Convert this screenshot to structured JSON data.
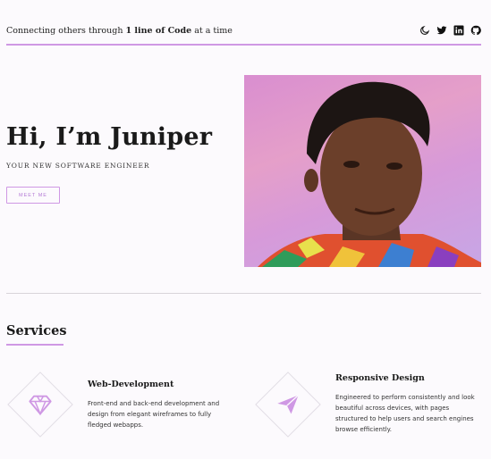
{
  "header": {
    "tagline_prefix": "Connecting others through ",
    "tagline_bold": "1 line of Code",
    "tagline_suffix": " at a time",
    "social_icons": [
      "moon-icon",
      "twitter-icon",
      "linkedin-icon",
      "github-icon"
    ]
  },
  "hero": {
    "title": "Hi, I’m Juniper",
    "subtitle": "YOUR NEW SOFTWARE ENGINEER",
    "button_label": "MEET ME"
  },
  "services": {
    "heading": "Services",
    "items": [
      {
        "icon": "diamond-gem-icon",
        "title": "Web-Development",
        "description": "Front-end and back-end development and design from elegant wireframes to fully fledged webapps."
      },
      {
        "icon": "paper-plane-icon",
        "title": "Responsive Design",
        "description": "Engineered to perform consistently and look beautiful across devices, with pages structured to help users and search engines browse efficiently."
      }
    ]
  },
  "colors": {
    "accent": "#cf98e4",
    "background": "#fcfafd",
    "text": "#1a1a1a"
  }
}
